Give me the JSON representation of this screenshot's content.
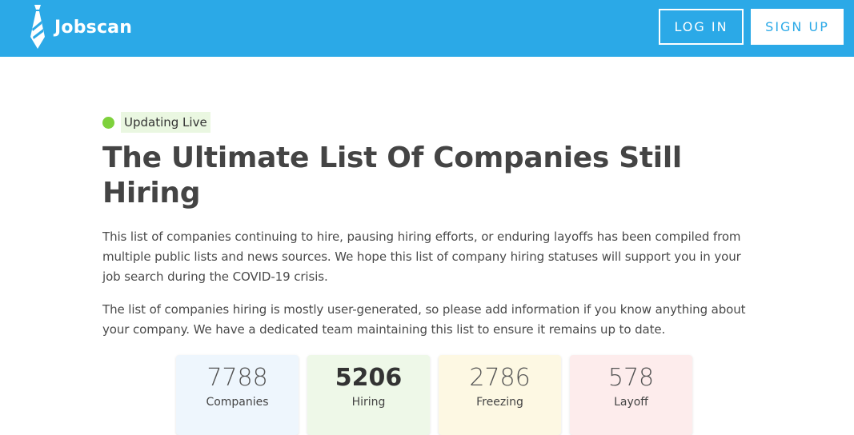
{
  "header": {
    "logo_text": "Jobscan",
    "login_label": "LOG IN",
    "signup_label": "SIGN UP",
    "brand_color": "#2ba9e7"
  },
  "main": {
    "live_badge": "Updating Live",
    "title": "The Ultimate List Of Companies Still Hiring",
    "paragraph_1": "This list of companies continuing to hire, pausing hiring efforts, or enduring layoffs has been compiled from multiple public lists and news sources. We hope this list of company hiring statuses will support you in your job search during the COVID-19 crisis.",
    "paragraph_2": "The list of companies hiring is mostly user-generated, so please add information if you know anything about your company. We have a dedicated team maintaining this list to ensure it remains up to date."
  },
  "stats": [
    {
      "value": "7788",
      "label": "Companies",
      "color": "#eef6fd"
    },
    {
      "value": "5206",
      "label": "Hiring",
      "color": "#eef8e8"
    },
    {
      "value": "2786",
      "label": "Freezing",
      "color": "#fdf8e3"
    },
    {
      "value": "578",
      "label": "Layoff",
      "color": "#fdecec"
    }
  ]
}
